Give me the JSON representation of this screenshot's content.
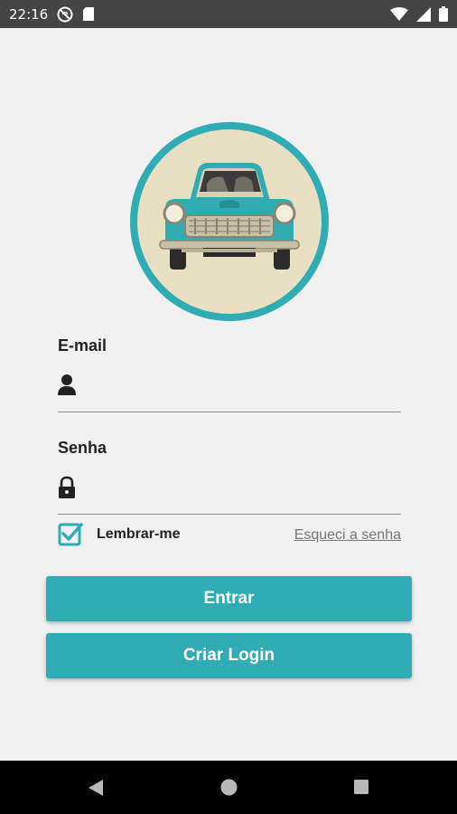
{
  "status_bar": {
    "time": "22:16"
  },
  "form": {
    "email": {
      "label": "E-mail",
      "value": "",
      "placeholder": ""
    },
    "password": {
      "label": "Senha",
      "value": "",
      "placeholder": ""
    },
    "remember": {
      "label": "Lembrar-me",
      "checked": true
    },
    "forgot_label": "Esqueci a senha"
  },
  "buttons": {
    "login_label": "Entrar",
    "create_label": "Criar Login"
  },
  "colors": {
    "accent": "#30acb4",
    "background": "#f1f1f1",
    "status_bar": "#444444",
    "nav_bar": "#000000"
  },
  "icons": {
    "logo": "vintage-car-logo",
    "email_field": "person-icon",
    "password_field": "lock-icon"
  }
}
